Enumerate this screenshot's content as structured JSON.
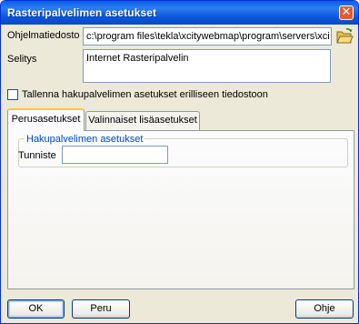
{
  "window": {
    "title": "Rasteripalvelimen asetukset",
    "close_glyph": "✕"
  },
  "form": {
    "program_file_label": "Ohjelmatiedosto",
    "program_file_value": "c:\\program files\\tekla\\xcitywebmap\\program\\servers\\xci",
    "description_label": "Selitys",
    "description_value": "Internet Rasteripalvelin",
    "save_separate_label": "Tallenna hakupalvelimen asetukset erilliseen tiedostoon",
    "save_separate_checked": false
  },
  "tabs": [
    {
      "label": "Perusasetukset",
      "active": true
    },
    {
      "label": "Valinnaiset lisäasetukset",
      "active": false
    }
  ],
  "group": {
    "title": "Hakupalvelimen asetukset",
    "identifier_label": "Tunniste",
    "identifier_value": ""
  },
  "buttons": {
    "ok": "OK",
    "cancel": "Peru",
    "help": "Ohje"
  },
  "icons": {
    "browse": "folder-open-icon",
    "close": "close-icon"
  }
}
